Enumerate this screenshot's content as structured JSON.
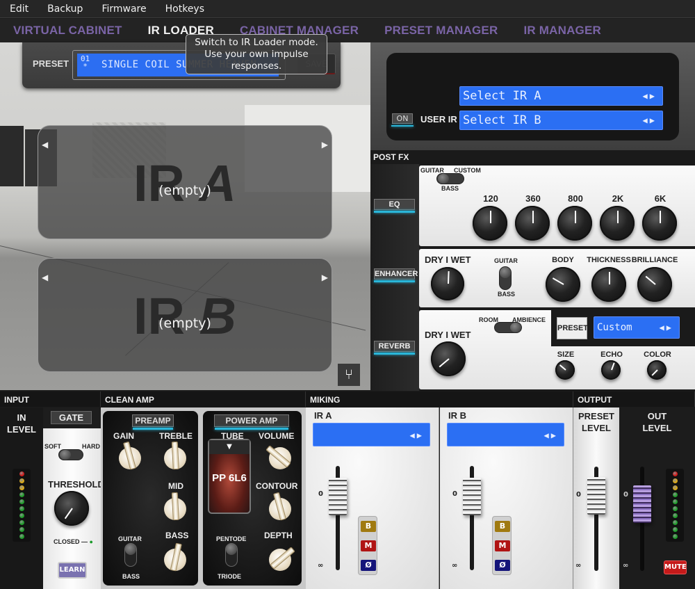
{
  "menu": [
    "Edit",
    "Backup",
    "Firmware",
    "Hotkeys"
  ],
  "tabs": [
    {
      "label": "VIRTUAL CABINET",
      "active": false
    },
    {
      "label": "IR LOADER",
      "active": true
    },
    {
      "label": "CABINET MANAGER",
      "active": false
    },
    {
      "label": "PRESET MANAGER",
      "active": false
    },
    {
      "label": "IR MANAGER",
      "active": false
    }
  ],
  "tooltip": "Switch to IR Loader mode. Use your own impulse responses.",
  "preset": {
    "label": "PRESET",
    "number": "01",
    "modified": "*",
    "name": "SINGLE COIL SUMMER HEAVEN",
    "save_label": "SAVE"
  },
  "ir_slots": [
    {
      "title": "IR",
      "letter": "A",
      "status": "(empty)"
    },
    {
      "title": "IR",
      "letter": "B",
      "status": "(empty)"
    }
  ],
  "user_ir": {
    "on_label": "ON",
    "label": "USER IR",
    "select_a": "Select IR A",
    "select_b": "Select IR B"
  },
  "post_fx": {
    "title": "POST FX",
    "eq": {
      "button": "EQ",
      "mode_left": "GUITAR",
      "mode_right": "CUSTOM",
      "mode_bottom": "BASS",
      "bands": [
        "120",
        "360",
        "800",
        "2K",
        "6K"
      ]
    },
    "enhancer": {
      "button": "ENHANCER",
      "drywet": "DRY I WET",
      "switch_top": "GUITAR",
      "switch_bottom": "BASS",
      "knobs": [
        "BODY",
        "THICKNESS",
        "BRILLIANCE"
      ]
    },
    "reverb": {
      "button": "REVERB",
      "drywet": "DRY I WET",
      "mode_left": "ROOM",
      "mode_right": "AMBIENCE",
      "preset_label": "PRESET",
      "preset_value": "Custom",
      "knobs": [
        "SIZE",
        "ECHO",
        "COLOR"
      ]
    }
  },
  "input": {
    "title": "INPUT",
    "in_level": "IN\nLEVEL",
    "gate": "GATE",
    "soft": "SOFT",
    "hard": "HARD",
    "threshold": "THRESHOLD",
    "closed": "CLOSED",
    "learn": "LEARN"
  },
  "clean_amp": {
    "title": "CLEAN AMP",
    "preamp": "PREAMP",
    "gain": "GAIN",
    "treble": "TREBLE",
    "mid": "MID",
    "bass": "BASS",
    "switch_top": "GUITAR",
    "switch_bottom": "BASS",
    "power_amp": "POWER AMP",
    "tube_label": "TUBE",
    "tube_value": "PP 6L6",
    "volume": "VOLUME",
    "contour": "CONTOUR",
    "depth": "DEPTH",
    "pentode": "PENTODE",
    "triode": "TRIODE"
  },
  "miking": {
    "title": "MIKING",
    "channels": [
      {
        "label": "IR A",
        "buttons": [
          "B",
          "M",
          "Ø"
        ]
      },
      {
        "label": "IR B",
        "buttons": [
          "B",
          "M",
          "Ø"
        ]
      }
    ],
    "zero": "0",
    "inf": "∞"
  },
  "output": {
    "title": "OUTPUT",
    "preset_level": "PRESET\nLEVEL",
    "out_level": "OUT\nLEVEL",
    "mute": "MUTE"
  },
  "colors": {
    "accent_purple": "#7a64a6",
    "lcd_blue": "#2b6ff3",
    "glow": "#2ab6d9",
    "mute_red": "#c51a1a"
  }
}
